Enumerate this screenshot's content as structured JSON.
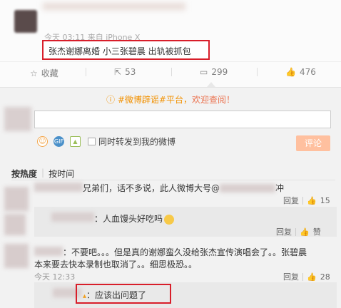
{
  "post": {
    "meta": "今天 03:11 来自 iPhone X",
    "text": "张杰谢娜离婚 小三张碧晨 出轨被抓包"
  },
  "actions": {
    "favorite": "收藏",
    "share_count": "53",
    "comment_count": "299",
    "like_count": "476"
  },
  "notice": {
    "prefix": "#微博辟谣#平台，",
    "highlight": "欢迎查阅！"
  },
  "composer": {
    "input_value": "",
    "repost_label": "同时转发到我的微博",
    "submit_label": "评论"
  },
  "sort": {
    "hot": "按热度",
    "time": "按时间"
  },
  "comments": [
    {
      "text": "兄弟们，话不多说，此人微博大号@",
      "text_tail": "冲",
      "reply": "回复",
      "likes": "15"
    },
    {
      "text": "：人血馒头好吃吗",
      "reply": "回复",
      "likes": "赞"
    },
    {
      "text": "：不要吧。。。但是真的谢娜蛮久没给张杰宣传演唱会了。。张碧晨",
      "text_line2": "本来要去快本录制也取消了。。细思极恐。。",
      "time": "今天 12:33",
      "reply": "回复",
      "likes": "28"
    },
    {
      "text": "：应该出问题了"
    }
  ]
}
